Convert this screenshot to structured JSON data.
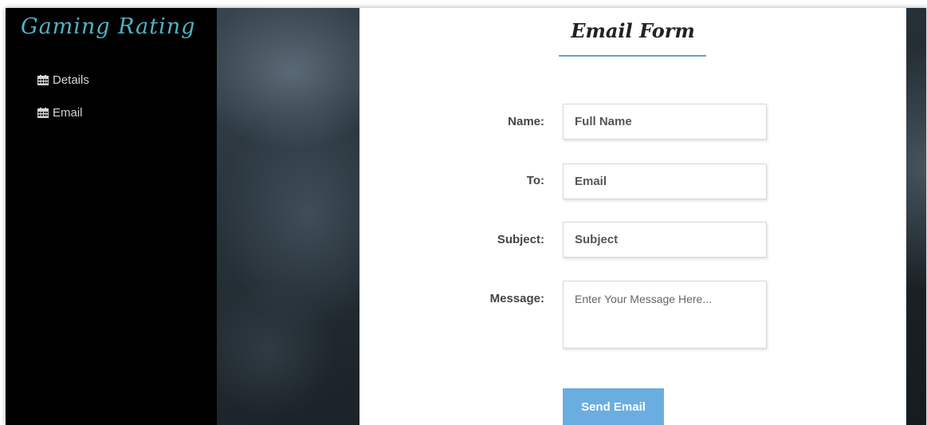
{
  "app": {
    "brand": "Gaming Rating"
  },
  "sidebar": {
    "items": [
      {
        "label": "Details",
        "icon": "calendar-icon"
      },
      {
        "label": "Email",
        "icon": "calendar-icon"
      }
    ]
  },
  "form": {
    "title": "Email Form",
    "fields": {
      "name": {
        "label": "Name:",
        "placeholder": "Full Name"
      },
      "to": {
        "label": "To:",
        "placeholder": "Email"
      },
      "subject": {
        "label": "Subject:",
        "placeholder": "Subject"
      },
      "message": {
        "label": "Message:",
        "placeholder": "Enter Your Message Here..."
      }
    },
    "submit_label": "Send Email"
  },
  "colors": {
    "brand": "#4fb3c7",
    "sidebar_bg": "#000000",
    "accent": "#5aa2d4",
    "button": "#6aade0"
  }
}
